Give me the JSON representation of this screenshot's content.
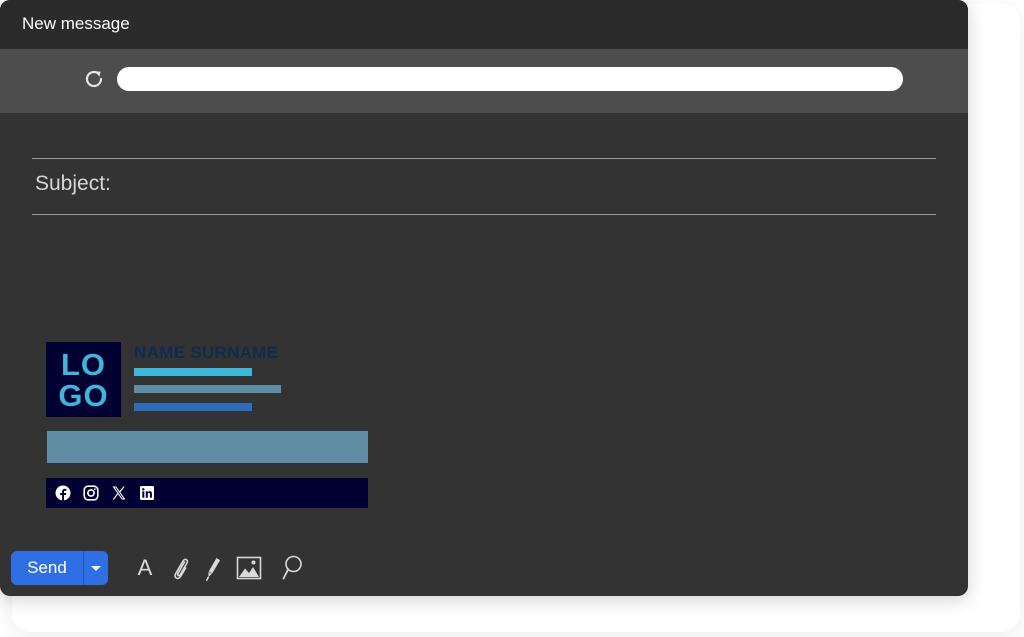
{
  "window": {
    "title": "New message"
  },
  "urlbar": {
    "value": "",
    "icon": "reload-icon"
  },
  "subject": {
    "label": "Subject:",
    "value": ""
  },
  "signature": {
    "logo_line1": "LO",
    "logo_line2": "GO",
    "name": "NAME SURNAME",
    "accent_colors": [
      "#3fb6d8",
      "#5f8da4",
      "#2f6bbb"
    ],
    "logo_bg": "#000033",
    "social_icons": [
      "facebook-icon",
      "instagram-icon",
      "x-icon",
      "linkedin-icon"
    ]
  },
  "toolbar": {
    "send_label": "Send",
    "font_label": "A",
    "icons": [
      "send-options-chevron-icon",
      "attach-paperclip-icon",
      "pen-icon",
      "image-icon",
      "search-icon"
    ]
  },
  "colors": {
    "window_bg": "#333333",
    "titlebar_bg": "#2b2b2b",
    "urlbar_bg": "#4d4d4d",
    "send_blue": "#2f6fe4"
  }
}
